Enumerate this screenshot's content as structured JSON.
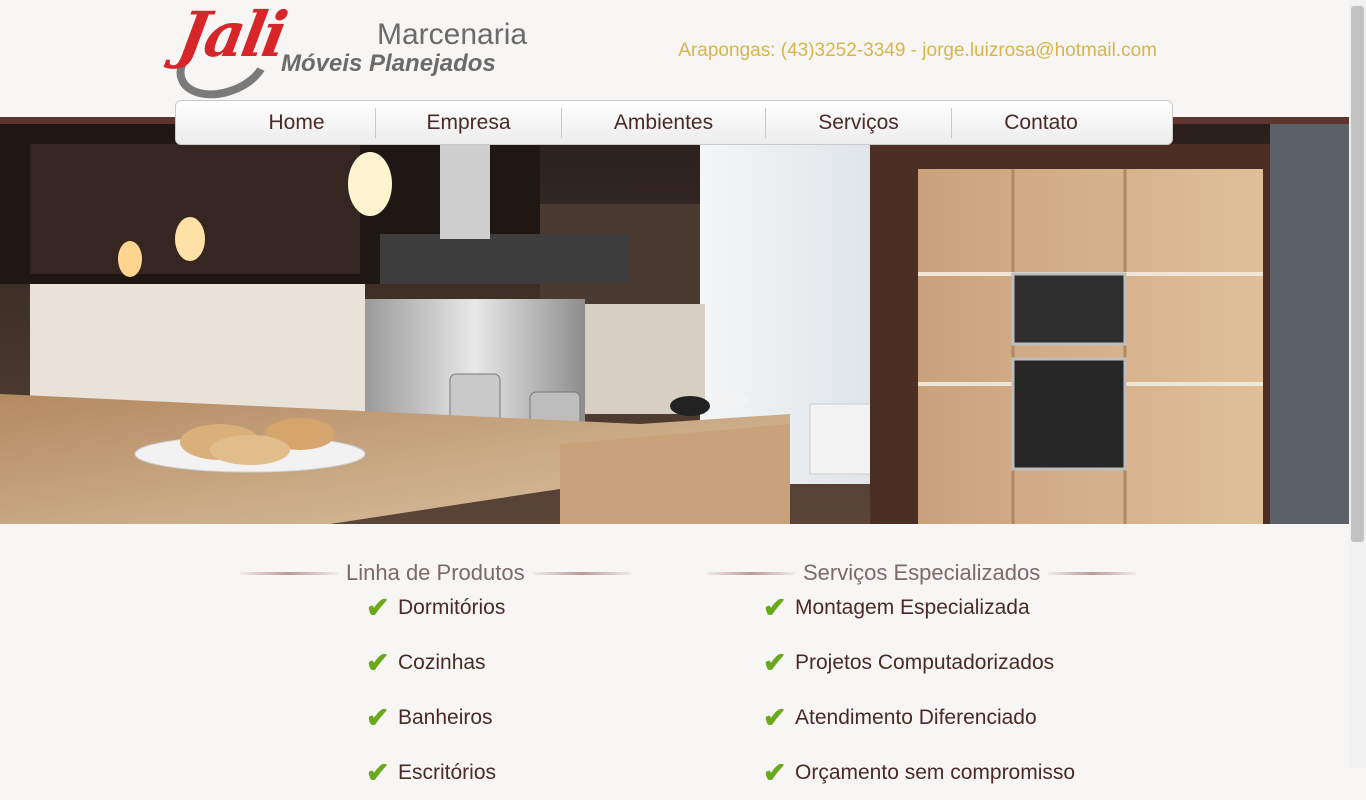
{
  "logo": {
    "brand": "Jali",
    "line1": "Marcenaria",
    "line2": "Móveis Planejados"
  },
  "contact": {
    "text": "Arapongas: (43)3252-3349 - jorge.luizrosa@hotmail.com"
  },
  "nav": {
    "items": [
      {
        "label": "Home"
      },
      {
        "label": "Empresa"
      },
      {
        "label": "Ambientes"
      },
      {
        "label": "Serviços"
      },
      {
        "label": "Contato"
      }
    ]
  },
  "hero": {
    "slides_total": 3,
    "active_slide": 1
  },
  "products": {
    "title": "Linha de Produtos",
    "items": [
      {
        "label": "Dormitórios"
      },
      {
        "label": "Cozinhas"
      },
      {
        "label": "Banheiros"
      },
      {
        "label": "Escritórios"
      }
    ]
  },
  "services": {
    "title": "Serviços Especializados",
    "items": [
      {
        "label": "Montagem Especializada"
      },
      {
        "label": "Projetos Computadorizados"
      },
      {
        "label": "Atendimento Diferenciado"
      },
      {
        "label": "Orçamento sem compromisso"
      }
    ]
  },
  "colors": {
    "accent_red": "#d6262a",
    "contact_gold": "#d8b54a",
    "text_brown": "#4a2a27",
    "check_green": "#6aa81e",
    "band_brown": "#5e3330"
  }
}
